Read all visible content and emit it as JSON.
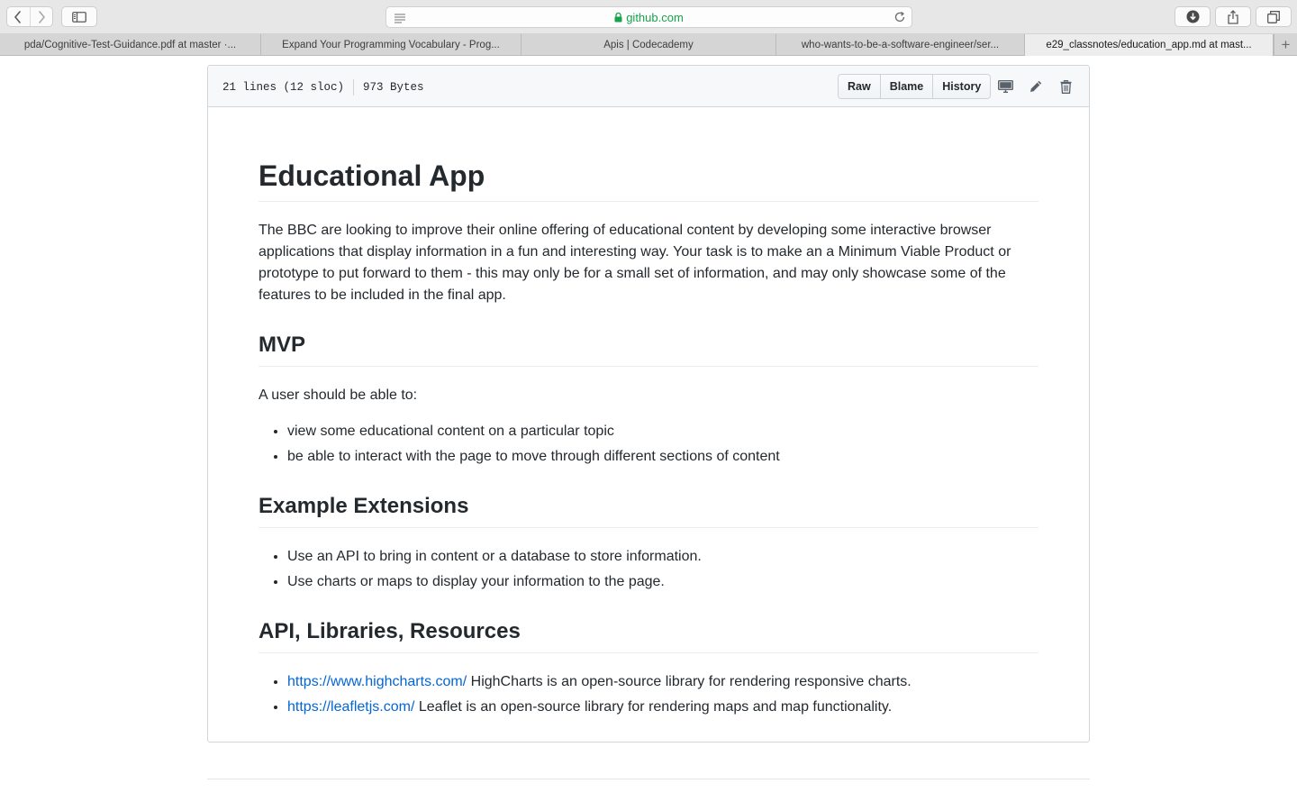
{
  "browser": {
    "url": "github.com",
    "tabs": [
      {
        "label": "pda/Cognitive-Test-Guidance.pdf at master ·...",
        "active": false
      },
      {
        "label": "Expand Your Programming Vocabulary - Prog...",
        "active": false
      },
      {
        "label": "Apis | Codecademy",
        "active": false
      },
      {
        "label": "who-wants-to-be-a-software-engineer/ser...",
        "active": false
      },
      {
        "label": "e29_classnotes/education_app.md at mast...",
        "active": true
      }
    ],
    "icons": {
      "back": "chevron-left-icon",
      "forward": "chevron-right-icon",
      "sidebar": "sidebar-icon",
      "reader": "reader-icon",
      "lock": "lock-icon",
      "reload": "reload-icon",
      "download": "download-icon",
      "share": "share-icon",
      "tabs": "tab-overview-icon",
      "new_tab": "plus-icon"
    }
  },
  "file": {
    "lines": "21 lines (12 sloc)",
    "size": "973 Bytes",
    "buttons": {
      "raw": "Raw",
      "blame": "Blame",
      "history": "History"
    },
    "icons": {
      "desktop": "desktop-icon",
      "edit": "pencil-icon",
      "delete": "trash-icon"
    }
  },
  "doc": {
    "title": "Educational App",
    "intro": "The BBC are looking to improve their online offering of educational content by developing some interactive browser applications that display information in a fun and interesting way. Your task is to make an a Minimum Viable Product or prototype to put forward to them - this may only be for a small set of information, and may only showcase some of the features to be included in the final app.",
    "mvp": {
      "heading": "MVP",
      "lead": "A user should be able to:",
      "items": [
        "view some educational content on a particular topic",
        "be able to interact with the page to move through different sections of content"
      ]
    },
    "extensions": {
      "heading": "Example Extensions",
      "items": [
        "Use an API to bring in content or a database to store information.",
        "Use charts or maps to display your information to the page."
      ]
    },
    "resources": {
      "heading": "API, Libraries, Resources",
      "items": [
        {
          "link": "https://www.highcharts.com/",
          "text": " HighCharts is an open-source library for rendering responsive charts."
        },
        {
          "link": "https://leafletjs.com/",
          "text": " Leaflet is an open-source library for rendering maps and map functionality."
        }
      ]
    }
  },
  "colors": {
    "link": "#0366d6",
    "secure_url": "#16a34a",
    "text": "#24292e"
  }
}
